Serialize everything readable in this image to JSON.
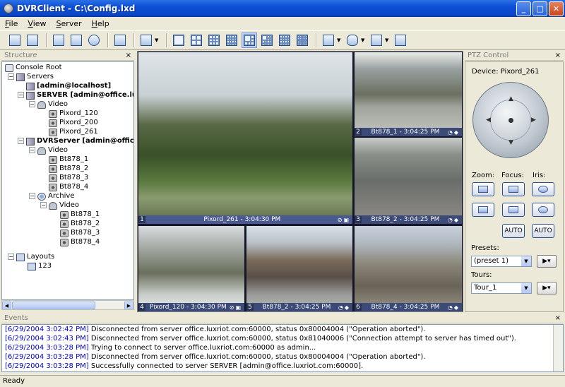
{
  "window": {
    "title": "DVRClient - C:\\Config.lxd",
    "min": "_",
    "max": "□",
    "close": "✕"
  },
  "menu": [
    {
      "key": "F",
      "rest": "ile"
    },
    {
      "key": "V",
      "rest": "iew",
      "prefix": ""
    },
    {
      "key": "S",
      "rest": "erver"
    },
    {
      "key": "H",
      "rest": "elp"
    }
  ],
  "structure": {
    "title": "Structure",
    "close": "×",
    "tree": {
      "root": "Console Root",
      "servers": "Servers",
      "server1": "[admin@localhost]",
      "server2": "SERVER [admin@office.luxriot.c",
      "video2": "Video",
      "cams2": [
        "Pixord_120",
        "Pixord_200",
        "Pixord_261"
      ],
      "server3": "DVRServer [admin@office.luxri",
      "video3": "Video",
      "cams3": [
        "Bt878_1",
        "Bt878_2",
        "Bt878_3",
        "Bt878_4"
      ],
      "archive": "Archive",
      "video4": "Video",
      "cams4": [
        "Bt878_1",
        "Bt878_2",
        "Bt878_3",
        "Bt878_4"
      ],
      "layouts": "Layouts",
      "layout1": "123"
    }
  },
  "cameras": [
    {
      "num": "1",
      "label": "Pixord_261 - 3:04:30 PM"
    },
    {
      "num": "2",
      "label": "Bt878_1 - 3:04:25 PM"
    },
    {
      "num": "3",
      "label": "Bt878_2 - 3:04:25 PM"
    },
    {
      "num": "4",
      "label": "Pixord_120 - 3:04:30 PM"
    },
    {
      "num": "5",
      "label": "Bt878_2 - 3:04:25 PM"
    },
    {
      "num": "6",
      "label": "Bt878_4 - 3:04:25 PM"
    }
  ],
  "ptz": {
    "title": "PTZ Control",
    "close": "×",
    "device": "Device: Pixord_261",
    "zoom": "Zoom:",
    "focus": "Focus:",
    "iris": "Iris:",
    "auto": "AUTO",
    "presets_label": "Presets:",
    "preset_value": "(preset 1)",
    "tours_label": "Tours:",
    "tour_value": "Tour_1"
  },
  "events": {
    "title": "Events",
    "close": "×",
    "rows": [
      {
        "time": "[6/29/2004 3:02:42 PM]",
        "msg": " Disconnected from server office.luxriot.com:60000, status 0x80004004 (\"Operation aborted\")."
      },
      {
        "time": "[6/29/2004 3:02:43 PM]",
        "msg": " Disconnected from server office.luxriot.com:60000, status 0x81040006 (\"Connection attempt to server has timed out\")."
      },
      {
        "time": "[6/29/2004 3:03:28 PM]",
        "msg": " Trying to connect to server office.luxriot.com:60000 as admin..."
      },
      {
        "time": "[6/29/2004 3:03:28 PM]",
        "msg": " Disconnected from server office.luxriot.com:60000, status 0x80004004 (\"Operation aborted\")."
      },
      {
        "time": "[6/29/2004 3:03:28 PM]",
        "msg": " Successfully connected to server SERVER [admin@office.luxriot.com:60000]."
      }
    ]
  },
  "status": "Ready"
}
